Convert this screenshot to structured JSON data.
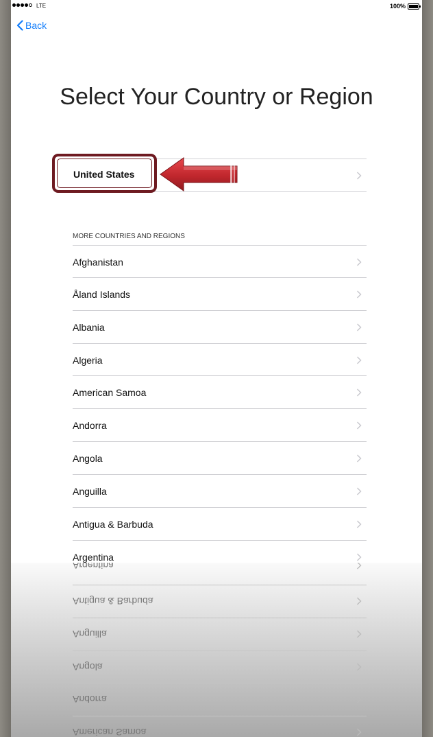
{
  "status_bar": {
    "carrier": "LTE",
    "battery": "100%"
  },
  "nav": {
    "back_label": "Back"
  },
  "page": {
    "title": "Select Your Country or Region"
  },
  "suggested": {
    "country": "United States"
  },
  "list": {
    "section_header": "MORE COUNTRIES AND REGIONS",
    "items": [
      "Afghanistan",
      "Åland Islands",
      "Albania",
      "Algeria",
      "American Samoa",
      "Andorra",
      "Angola",
      "Anguilla",
      "Antigua & Barbuda",
      "Argentina"
    ]
  },
  "colors": {
    "accent": "#147efb",
    "highlight": "#6e1a21",
    "arrow": "#c0272d"
  },
  "icons": {
    "back": "chevron-left-icon",
    "row": "chevron-right-icon",
    "annotation": "red-arrow"
  }
}
